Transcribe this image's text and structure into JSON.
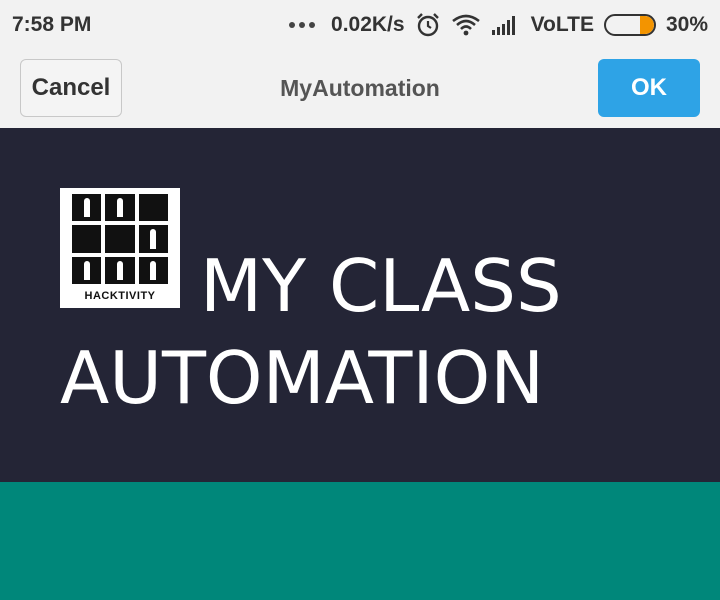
{
  "status_bar": {
    "time": "7:58 PM",
    "network_speed": "0.02K/s",
    "network_type": "VoLTE",
    "battery_percent": "30%",
    "battery_level": 0.3,
    "icons": [
      "more-dots-icon",
      "alarm-icon",
      "wifi-icon",
      "signal-icon",
      "battery-icon"
    ]
  },
  "header": {
    "cancel_label": "Cancel",
    "title": "MyAutomation",
    "ok_label": "OK"
  },
  "hero": {
    "logo_text": "HACKTIVITY",
    "title_line1": "MY CLASS",
    "title_line2": "AUTOMATION"
  },
  "colors": {
    "hero_bg": "#242536",
    "teal_bg": "#00877a",
    "ok_bg": "#2ea3e6",
    "battery_fill": "#f39400"
  }
}
